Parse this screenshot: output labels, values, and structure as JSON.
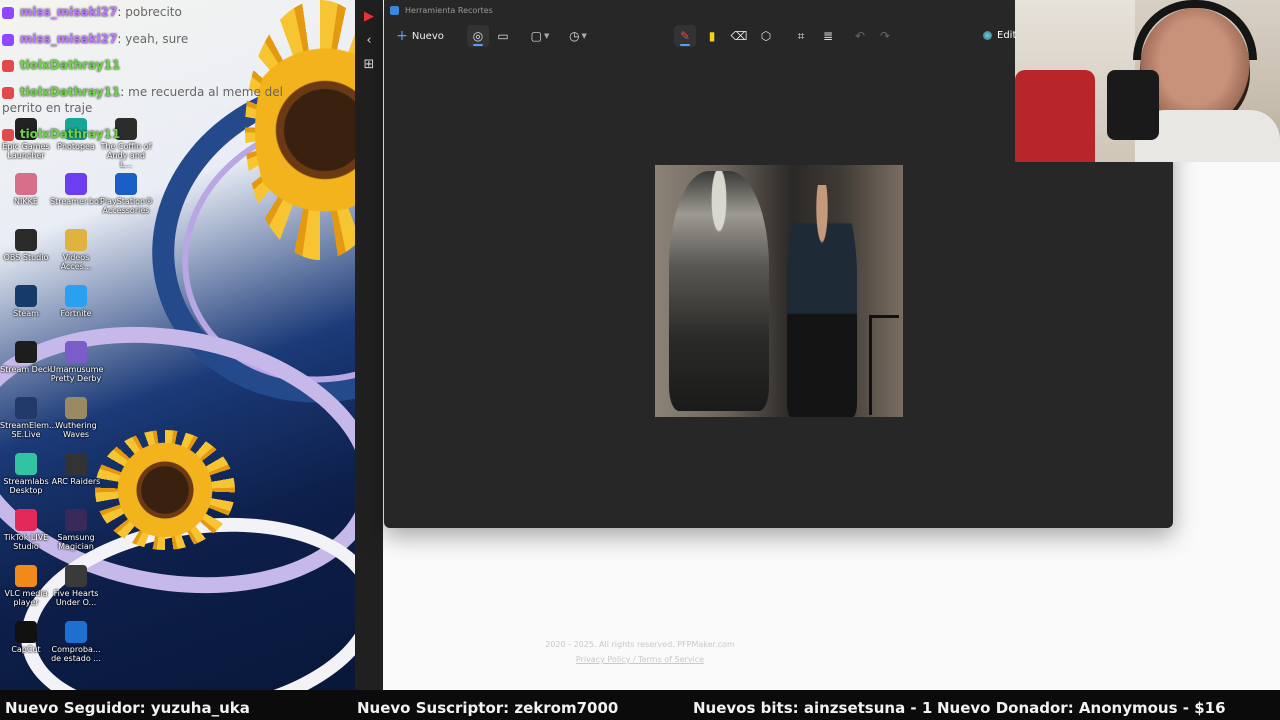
{
  "chat": {
    "messages": [
      {
        "user": "miss_misaki27",
        "text": "pobrecito"
      },
      {
        "user": "miss_misaki27",
        "text": "yeah, sure"
      },
      {
        "user": "tiolxDathray11",
        "text": ""
      },
      {
        "user": "tiolxDathray11",
        "text": "me recuerda al meme del perrito en traje"
      },
      {
        "user": "tiolxDathray11",
        "text": ""
      }
    ]
  },
  "desktop": {
    "icons": [
      {
        "label": "Epic Games Launcher",
        "icon": "epic-icon",
        "color": "#222222"
      },
      {
        "label": "Photopea",
        "icon": "photopea-icon",
        "color": "#18a497"
      },
      {
        "label": "The Coffin of Andy and L...",
        "icon": "game-icon",
        "color": "#2c2c2c"
      },
      {
        "label": "NIKKE",
        "icon": "nikke-icon",
        "color": "#d86f8a"
      },
      {
        "label": "Streamer.bot",
        "icon": "bot-icon",
        "color": "#6d3df2"
      },
      {
        "label": "PlayStation® Accessories",
        "icon": "playstation-icon",
        "color": "#1a5ec8"
      },
      {
        "label": "OBS Studio",
        "icon": "obs-icon",
        "color": "#2a2a2a"
      },
      {
        "label": "Videos Acces...",
        "icon": "folder-icon",
        "color": "#e0b341"
      },
      {
        "label": "Steam",
        "icon": "steam-icon",
        "color": "#163b6b"
      },
      {
        "label": "Fortnite",
        "icon": "fortnite-icon",
        "color": "#2aa0f0"
      },
      {
        "label": "Stream Deck",
        "icon": "streamdeck-icon",
        "color": "#1d1d1d"
      },
      {
        "label": "Umamusume Pretty Derby",
        "icon": "umamusume-icon",
        "color": "#7c5cc9"
      },
      {
        "label": "StreamElem... SE.Live",
        "icon": "streamelements-icon",
        "color": "#223a6a"
      },
      {
        "label": "Wuthering Waves",
        "icon": "wuwa-icon",
        "color": "#9a8a64"
      },
      {
        "label": "Streamlabs Desktop",
        "icon": "streamlabs-icon",
        "color": "#31c3a2"
      },
      {
        "label": "ARC Raiders",
        "icon": "arc-icon",
        "color": "#333333"
      },
      {
        "label": "TikTok LIVE Studio",
        "icon": "tiktok-icon",
        "color": "#e3285a"
      },
      {
        "label": "Samsung Magician",
        "icon": "samsung-icon",
        "color": "#3a2a5a"
      },
      {
        "label": "VLC media player",
        "icon": "vlc-icon",
        "color": "#f08a18"
      },
      {
        "label": "Five Hearts Under O...",
        "icon": "game-icon",
        "color": "#3a3a3a"
      },
      {
        "label": "CapCut",
        "icon": "capcut-icon",
        "color": "#111111"
      },
      {
        "label": "Comproba... de estado ...",
        "icon": "health-icon",
        "color": "#1f6fd0"
      }
    ]
  },
  "snipping_tool": {
    "title": "Herramienta Recortes",
    "new_label": "Nuevo",
    "toolbar": [
      {
        "name": "screenshot-mode-icon",
        "glyph": "◎"
      },
      {
        "name": "video-mode-icon",
        "glyph": "▭"
      },
      {
        "name": "snip-shape-icon",
        "glyph": "▢"
      },
      {
        "name": "timer-icon",
        "glyph": "◷"
      },
      {
        "name": "pen-icon",
        "glyph": "✎"
      },
      {
        "name": "highlighter-icon",
        "glyph": "▮"
      },
      {
        "name": "eraser-icon",
        "glyph": "⌫"
      },
      {
        "name": "shapes-icon",
        "glyph": "⬡"
      },
      {
        "name": "crop-icon",
        "glyph": "⌗"
      },
      {
        "name": "text-actions-icon",
        "glyph": "≣"
      },
      {
        "name": "undo-icon",
        "glyph": "↶"
      },
      {
        "name": "redo-icon",
        "glyph": "↷"
      }
    ],
    "edit_label": "Edit"
  },
  "page": {
    "footer_copyright": "2020 - 2025. All rights reserved. PFPMaker.com",
    "footer_links": "Privacy Policy / Terms of Service"
  },
  "ticker": {
    "follower": "Nuevo Seguidor: yuzuha_uka",
    "subscriber": "Nuevo Suscriptor: zekrom7000",
    "bits": "Nuevos bits: ainzsetsuna - 1",
    "donor": "Nuevo Donador: Anonymous - $16"
  },
  "colors": {
    "accent_blue": "#4ea1ff",
    "chat_purple": "#c07bff",
    "chat_green": "#6fd34a",
    "pen_red": "#e44b4b",
    "highlighter_yellow": "#f2d21a"
  }
}
